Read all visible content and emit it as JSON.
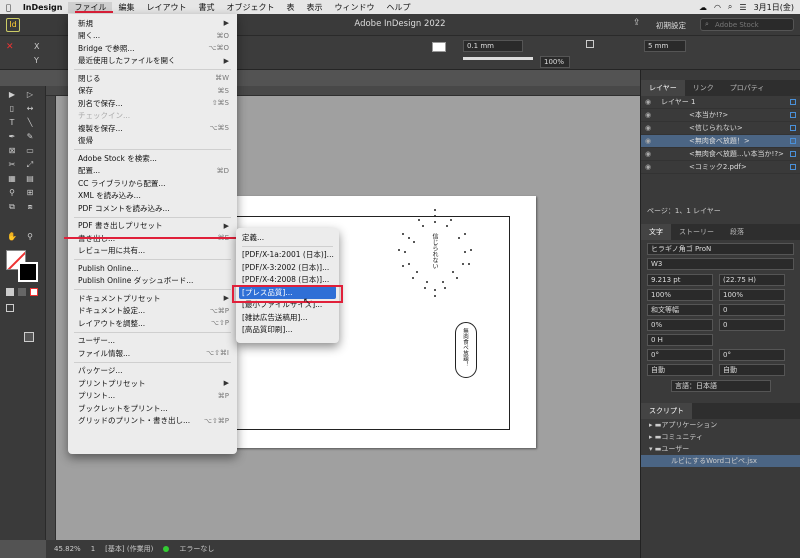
{
  "menubar": {
    "app": "InDesign",
    "items": [
      "ファイル",
      "編集",
      "レイアウト",
      "書式",
      "オブジェクト",
      "表",
      "表示",
      "ウィンドウ",
      "ヘルプ"
    ],
    "date": "3月1日(金)"
  },
  "appbar": {
    "title": "Adobe InDesign 2022",
    "workspace": "初期設定",
    "search_placeholder": "Adobe Stock"
  },
  "control": {
    "stroke": "0.1 mm",
    "zoom": "100%",
    "gap": "5 mm"
  },
  "file_menu": [
    {
      "label": "新規",
      "sc": "",
      "sub": true
    },
    {
      "label": "開く...",
      "sc": "⌘O"
    },
    {
      "label": "Bridge で参照...",
      "sc": "⌥⌘O"
    },
    {
      "label": "最近使用したファイルを開く",
      "sc": "",
      "sub": true
    },
    {
      "sep": true
    },
    {
      "label": "閉じる",
      "sc": "⌘W"
    },
    {
      "label": "保存",
      "sc": "⌘S"
    },
    {
      "label": "別名で保存...",
      "sc": "⇧⌘S"
    },
    {
      "label": "チェックイン...",
      "sc": "",
      "dis": true
    },
    {
      "label": "複製を保存...",
      "sc": "⌥⌘S"
    },
    {
      "label": "復帰",
      "sc": ""
    },
    {
      "sep": true
    },
    {
      "label": "Adobe Stock を検索...",
      "sc": ""
    },
    {
      "label": "配置...",
      "sc": "⌘D"
    },
    {
      "label": "CC ライブラリから配置...",
      "sc": ""
    },
    {
      "label": "XML を読み込み...",
      "sc": ""
    },
    {
      "label": "PDF コメントを読み込み...",
      "sc": ""
    },
    {
      "sep": true
    },
    {
      "label": "PDF 書き出しプリセット",
      "sc": "",
      "sub": true,
      "hi": true
    },
    {
      "label": "書き出し...",
      "sc": "⌘E"
    },
    {
      "label": "レビュー用に共有...",
      "sc": ""
    },
    {
      "sep": true
    },
    {
      "label": "Publish Online...",
      "sc": ""
    },
    {
      "label": "Publish Online ダッシュボード...",
      "sc": ""
    },
    {
      "sep": true
    },
    {
      "label": "ドキュメントプリセット",
      "sc": "",
      "sub": true
    },
    {
      "label": "ドキュメント設定...",
      "sc": "⌥⌘P"
    },
    {
      "label": "レイアウトを調整...",
      "sc": "⌥⇧P"
    },
    {
      "sep": true
    },
    {
      "label": "ユーザー...",
      "sc": ""
    },
    {
      "label": "ファイル情報...",
      "sc": "⌥⇧⌘I"
    },
    {
      "sep": true
    },
    {
      "label": "パッケージ...",
      "sc": ""
    },
    {
      "label": "プリントプリセット",
      "sc": "",
      "sub": true
    },
    {
      "label": "プリント...",
      "sc": "⌘P"
    },
    {
      "label": "ブックレットをプリント...",
      "sc": ""
    },
    {
      "label": "グリッドのプリント・書き出し...",
      "sc": "⌥⇧⌘P"
    }
  ],
  "submenu": [
    {
      "label": "定義..."
    },
    {
      "sep": true
    },
    {
      "label": "[PDF/X-1a:2001 (日本)]..."
    },
    {
      "label": "[PDF/X-3:2002 (日本)]..."
    },
    {
      "label": "[PDF/X-4:2008 (日本)]..."
    },
    {
      "label": "[プレス品質]...",
      "sel": true
    },
    {
      "label": "[最小ファイルサイズ]..."
    },
    {
      "label": "[雑誌広告送稿用]..."
    },
    {
      "label": "[高品質印刷]..."
    }
  ],
  "canvas": {
    "bubble1": "信じられない",
    "bubble2": "無肉食べ放題！"
  },
  "status": {
    "zoom": "45.82%",
    "page": "1",
    "style": "[基本] (作業用)",
    "preflight": "エラーなし"
  },
  "layers_panel": {
    "tabs": [
      "レイヤー",
      "リンク",
      "プロパティ"
    ],
    "rows": [
      {
        "label": "レイヤー 1",
        "indent": 0
      },
      {
        "label": "<本当か!?>",
        "indent": 1
      },
      {
        "label": "<信じられない>",
        "indent": 1
      },
      {
        "label": "<無肉食べ放題！>",
        "indent": 1,
        "sel": true
      },
      {
        "label": "<無肉食べ放題...い本当か!?>",
        "indent": 1
      },
      {
        "label": "<コミック2.pdf>",
        "indent": 1
      }
    ],
    "footer": "ページ：1、1 レイヤー"
  },
  "char_panel": {
    "tabs": [
      "文字",
      "ストーリー",
      "段落"
    ],
    "font": "ヒラギノ角ゴ ProN",
    "weight": "W3",
    "size": "9.213 pt",
    "leading": "(22.75 H)",
    "vscale": "100%",
    "hscale": "100%",
    "mojikumi": "和文等幅",
    "kerning": "0",
    "tsume": "0%",
    "tracking": "0",
    "baseline": "0 H",
    "skew": "0°",
    "rotate": "0°",
    "auto1": "自動",
    "auto2": "自動",
    "lang_label": "言語：日本語"
  },
  "scripts_panel": {
    "title": "スクリプト",
    "items": [
      "アプリケーション",
      "コミュニティ",
      "ユーザー",
      "ルビにするWordコピペ.jsx"
    ]
  }
}
